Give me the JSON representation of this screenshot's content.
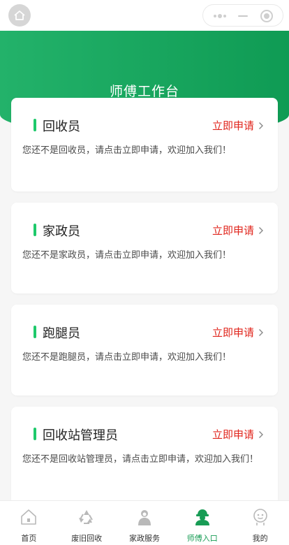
{
  "header": {
    "title": "师傅工作台"
  },
  "cards": [
    {
      "title": "回收员",
      "action": "立即申请",
      "desc": "您还不是回收员，请点击立即申请，欢迎加入我们！"
    },
    {
      "title": "家政员",
      "action": "立即申请",
      "desc": "您还不是家政员，请点击立即申请，欢迎加入我们！"
    },
    {
      "title": "跑腿员",
      "action": "立即申请",
      "desc": "您还不是跑腿员，请点击立即申请，欢迎加入我们！"
    },
    {
      "title": "回收站管理员",
      "action": "立即申请",
      "desc": "您还不是回收站管理员，请点击立即申请，欢迎加入我们！"
    }
  ],
  "tabbar": {
    "items": [
      {
        "label": "首页",
        "icon": "home-icon"
      },
      {
        "label": "废旧回收",
        "icon": "recycle-icon"
      },
      {
        "label": "家政服务",
        "icon": "housekeeper-icon"
      },
      {
        "label": "师傅入口",
        "icon": "worker-icon",
        "active": true
      },
      {
        "label": "我的",
        "icon": "profile-icon"
      }
    ]
  },
  "colors": {
    "accent": "#1ec96b",
    "action": "#e0241b",
    "header": "#12a05a",
    "active_tab": "#189c55"
  }
}
